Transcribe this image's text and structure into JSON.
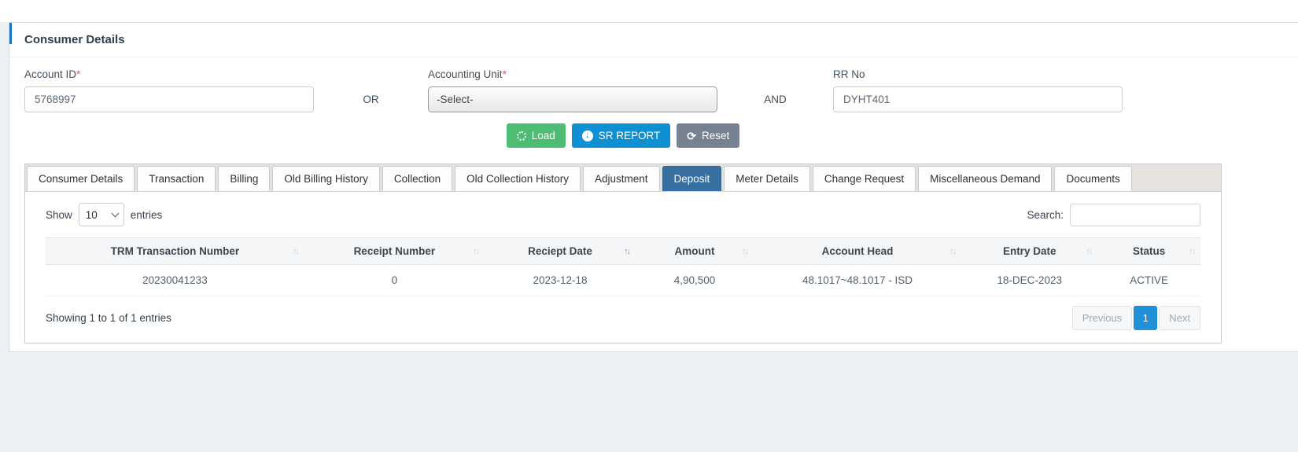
{
  "card": {
    "title": "Consumer Details"
  },
  "form": {
    "account_id": {
      "label": "Account ID",
      "required_mark": "*",
      "value": "5768997"
    },
    "or_label": "OR",
    "accounting_unit": {
      "label": "Accounting Unit",
      "required_mark": "*",
      "value": "-Select-"
    },
    "and_label": "AND",
    "rr_no": {
      "label": "RR No",
      "value": "DYHT401"
    }
  },
  "buttons": {
    "load": "Load",
    "sr_report": "SR REPORT",
    "reset": "Reset"
  },
  "tabs": [
    {
      "label": "Consumer Details",
      "active": false
    },
    {
      "label": "Transaction",
      "active": false
    },
    {
      "label": "Billing",
      "active": false
    },
    {
      "label": "Old Billing History",
      "active": false
    },
    {
      "label": "Collection",
      "active": false
    },
    {
      "label": "Old Collection History",
      "active": false
    },
    {
      "label": "Adjustment",
      "active": false
    },
    {
      "label": "Deposit",
      "active": true
    },
    {
      "label": "Meter Details",
      "active": false
    },
    {
      "label": "Change Request",
      "active": false
    },
    {
      "label": "Miscellaneous Demand",
      "active": false
    },
    {
      "label": "Documents",
      "active": false
    }
  ],
  "table_controls": {
    "show_label": "Show",
    "page_length": "10",
    "entries_label": "entries",
    "search_label": "Search:",
    "search_value": ""
  },
  "table": {
    "columns": [
      "TRM Transaction Number",
      "Receipt Number",
      "Reciept Date",
      "Amount",
      "Account Head",
      "Entry Date",
      "Status"
    ],
    "sorted_column": "Reciept Date",
    "rows": [
      [
        "20230041233",
        "0",
        "2023-12-18",
        "4,90,500",
        "48.1017~48.1017 - ISD",
        "18-DEC-2023",
        "ACTIVE"
      ]
    ]
  },
  "footer": {
    "info": "Showing 1 to 1 of 1 entries",
    "previous": "Previous",
    "page": "1",
    "next": "Next"
  },
  "icons": {
    "sort": "↑↓",
    "sr_report_arrow": "↓"
  },
  "colors": {
    "accent_blue": "#1a73c7",
    "load_green": "#4dbd74",
    "sr_blue": "#0e90d2",
    "reset_gray": "#768192",
    "active_tab_blue": "#37709e",
    "pagination_active_blue": "#2090d9",
    "required_red": "#e55353"
  }
}
